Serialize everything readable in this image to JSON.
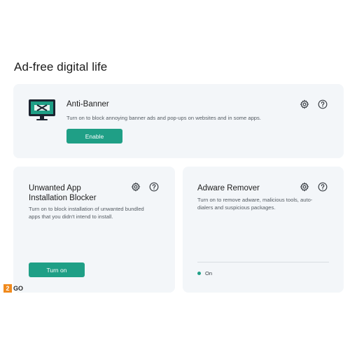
{
  "section": {
    "title": "Ad-free digital life"
  },
  "anti_banner": {
    "title": "Anti-Banner",
    "description": "Turn on to block annoying banner ads and pop-ups on websites and in some apps.",
    "button_label": "Enable",
    "icon": "monitor-icon"
  },
  "unwanted_app": {
    "title_line1": "Unwanted App",
    "title_line2": "Installation Blocker",
    "description_line1": "Turn on to block installation of unwanted bundled",
    "description_line2": "apps that you didn't intend to install.",
    "button_label": "Turn on"
  },
  "adware": {
    "title": "Adware Remover",
    "description_line1": "Turn on to remove adware, malicious tools, auto-",
    "description_line2": "dialers and suspicious packages.",
    "status": "On"
  },
  "watermark": {
    "badge": "2",
    "text": "GO"
  },
  "colors": {
    "accent": "#1f9f86",
    "card_bg": "#f3f6f9",
    "logo": "#f08a1d"
  }
}
